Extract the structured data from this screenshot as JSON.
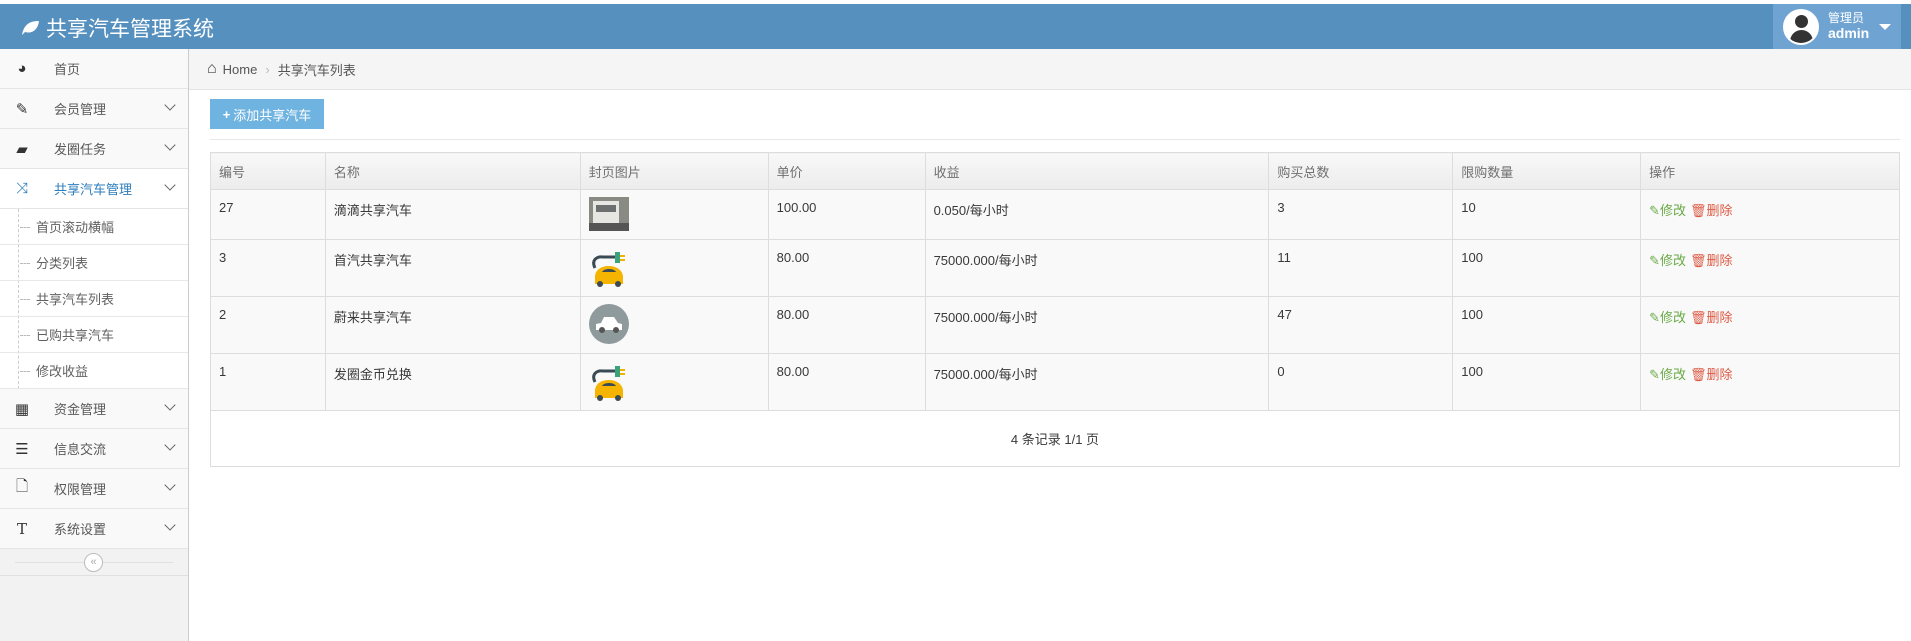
{
  "header": {
    "title": "共享汽车管理系统",
    "user_role": "管理员",
    "user_name": "admin"
  },
  "sidebar": {
    "items": [
      {
        "label": "首页",
        "icon": "dashboard-icon"
      },
      {
        "label": "会员管理",
        "icon": "edit-icon"
      },
      {
        "label": "发圈任务",
        "icon": "book-icon"
      },
      {
        "label": "共享汽车管理",
        "icon": "shuffle-icon",
        "active": true
      },
      {
        "label": "资金管理",
        "icon": "calendar-icon"
      },
      {
        "label": "信息交流",
        "icon": "list-icon"
      },
      {
        "label": "权限管理",
        "icon": "file-icon"
      },
      {
        "label": "系统设置",
        "icon": "text-icon"
      }
    ],
    "subitems": [
      "首页滚动横幅",
      "分类列表",
      "共享汽车列表",
      "已购共享汽车",
      "修改收益"
    ],
    "collapse_glyph": "«"
  },
  "breadcrumb": {
    "home": "Home",
    "current": "共享汽车列表"
  },
  "toolbar": {
    "add_label": "添加共享汽车"
  },
  "table": {
    "headers": [
      "编号",
      "名称",
      "封页图片",
      "单价",
      "收益",
      "购买总数",
      "限购数量",
      "操作"
    ],
    "rows": [
      {
        "id": "27",
        "name": "滴滴共享汽车",
        "image": "photo",
        "price": "100.00",
        "income": "0.050/每小时",
        "total": "3",
        "limit": "10"
      },
      {
        "id": "3",
        "name": "首汽共享汽车",
        "image": "ev",
        "price": "80.00",
        "income": "75000.000/每小时",
        "total": "11",
        "limit": "100"
      },
      {
        "id": "2",
        "name": "蔚来共享汽车",
        "image": "circle",
        "price": "80.00",
        "income": "75000.000/每小时",
        "total": "47",
        "limit": "100"
      },
      {
        "id": "1",
        "name": "发圈金币兑换",
        "image": "ev",
        "price": "80.00",
        "income": "75000.000/每小时",
        "total": "0",
        "limit": "100"
      }
    ],
    "edit_label": "修改",
    "delete_label": "删除",
    "footer": "4 条记录 1/1 页"
  },
  "colors": {
    "header": "#5590bf",
    "edit": "#69aa46",
    "delete": "#dd5a43",
    "button": "#6fb3e0"
  }
}
